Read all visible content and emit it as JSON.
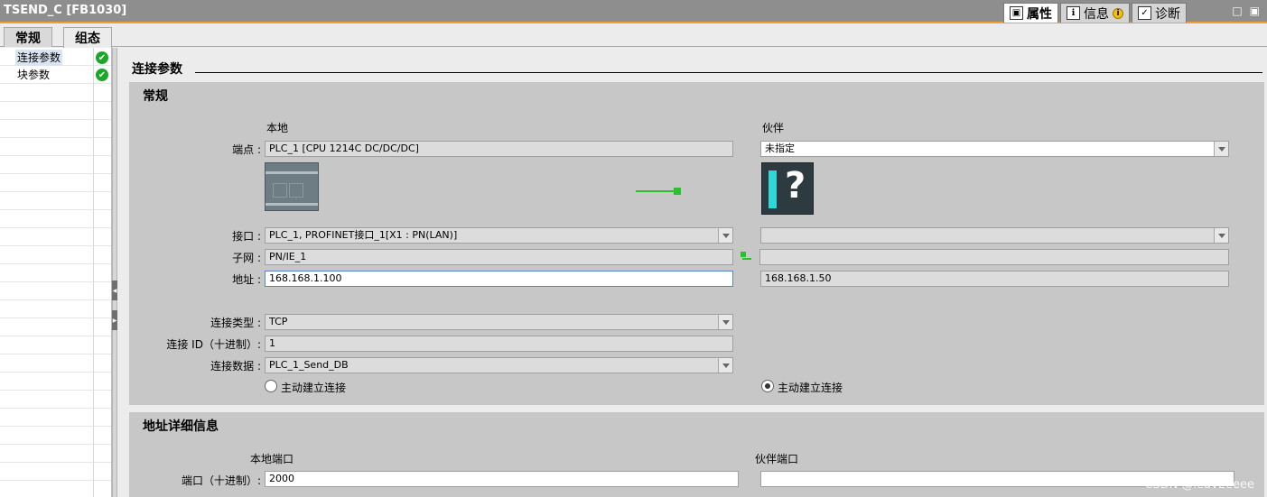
{
  "window": {
    "title": "TSEND_C [FB1030]"
  },
  "panel_tabs": [
    {
      "label": "属性",
      "icon": "properties-icon"
    },
    {
      "label": "信息",
      "icon": "info-icon",
      "badge": "i"
    },
    {
      "label": "诊断",
      "icon": "diagnostics-icon"
    }
  ],
  "window_buttons": {
    "restore": "□",
    "maximize": "▣"
  },
  "tabs": {
    "general": "常规",
    "config": "组态"
  },
  "nav": {
    "items": [
      {
        "label": "连接参数",
        "check": "✔"
      },
      {
        "label": "块参数",
        "check": "✔"
      }
    ]
  },
  "splitter": {
    "collapse": "◀",
    "expand": "▶"
  },
  "main": {
    "heading": "连接参数",
    "general": {
      "title": "常规",
      "local_header": "本地",
      "partner_header": "伙伴",
      "endpoint_label": "端点 :",
      "local_endpoint": "PLC_1 [CPU 1214C DC/DC/DC]",
      "partner_endpoint": "未指定",
      "partner_image_symbol": "?",
      "interface_label": "接口 :",
      "local_interface": "PLC_1, PROFINET接口_1[X1 : PN(LAN)]",
      "partner_interface": "",
      "subnet_label": "子网 :",
      "local_subnet": "PN/IE_1",
      "partner_subnet": "",
      "address_label": "地址 :",
      "local_address": "168.168.1.100",
      "partner_address": "168.168.1.50",
      "conn_type_label": "连接类型 :",
      "conn_type": "TCP",
      "conn_id_label": "连接 ID（十进制）:",
      "conn_id": "1",
      "conn_data_label": "连接数据 :",
      "conn_data": "PLC_1_Send_DB",
      "local_active_label": "主动建立连接",
      "partner_active_label": "主动建立连接",
      "local_active": false,
      "partner_active": true
    },
    "address_details": {
      "title": "地址详细信息",
      "local_port_header": "本地端口",
      "partner_port_header": "伙伴端口",
      "port_label": "端口（十进制）:",
      "local_port": "2000",
      "partner_port": ""
    }
  },
  "watermark": "CSDN @leavEeeee",
  "colors": {
    "accent": "#f0a030",
    "ok_green": "#1aa829",
    "link_green": "#2cc12c",
    "focus_border": "#5a84c0"
  }
}
